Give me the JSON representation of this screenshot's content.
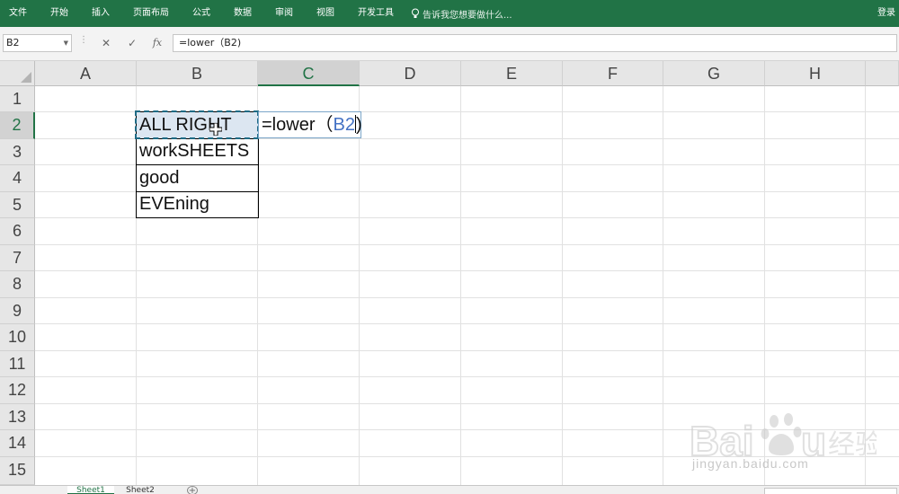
{
  "ribbon": {
    "tabs": [
      "文件",
      "开始",
      "插入",
      "页面布局",
      "公式",
      "数据",
      "审阅",
      "视图",
      "开发工具"
    ],
    "tell_me": "告诉我您想要做什么...",
    "login": "登录"
  },
  "formula_bar": {
    "name_box": "B2",
    "cancel": "✕",
    "enter": "✓",
    "fx": "fx",
    "formula": "=lower（B2)"
  },
  "columns": [
    "A",
    "B",
    "C",
    "D",
    "E",
    "F",
    "G",
    "H"
  ],
  "rows": [
    "1",
    "2",
    "3",
    "4",
    "5",
    "6",
    "7",
    "8",
    "9",
    "10",
    "11",
    "12",
    "13",
    "14",
    "15"
  ],
  "selected_column": "C",
  "selected_row": "2",
  "cells": {
    "B2": "ALL RIGHT",
    "B3": "workSHEETS",
    "B4": "good",
    "B5": "EVEning"
  },
  "editing_cell": {
    "ref": "C2",
    "prefix": "=lower（",
    "reference": "B2",
    "suffix": ")"
  },
  "sheets": [
    "Sheet1",
    "Sheet2"
  ],
  "active_sheet": "Sheet1",
  "watermark": {
    "text": "jingyan.baidu.com"
  },
  "colors": {
    "ribbon": "#217346",
    "reference": "#4472c4",
    "copy_border": "#1f6b85"
  }
}
